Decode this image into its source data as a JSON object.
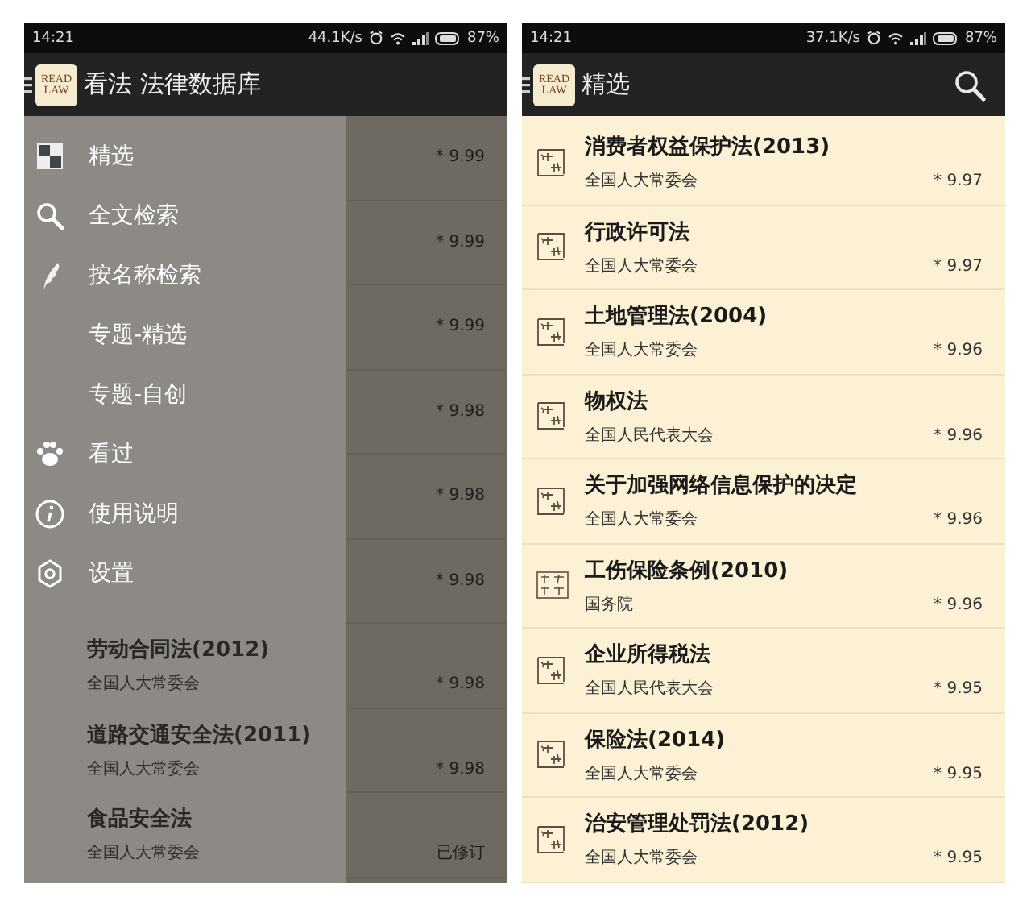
{
  "screens": [
    {
      "status_bar": {
        "time": "14:21",
        "speed": "44.1K/s",
        "battery": "87%"
      },
      "app_bar": {
        "logo_top": "READ",
        "logo_bottom": "LAW",
        "title": "看法 法律数据库",
        "search": false
      },
      "list": [
        {
          "rating": "* 9.99"
        },
        {
          "rating": "* 9.99"
        },
        {
          "rating": "* 9.99"
        },
        {
          "rating": "* 9.98"
        },
        {
          "rating": "* 9.98"
        },
        {
          "rating": "* 9.98"
        },
        {
          "title": "劳动合同法(2012)",
          "subtitle": "全国人大常委会",
          "rating": "* 9.98"
        },
        {
          "title": "道路交通安全法(2011)",
          "subtitle": "全国人大常委会",
          "rating": "* 9.98"
        },
        {
          "title": "食品安全法",
          "subtitle": "全国人大常委会",
          "rating": "已修订"
        }
      ],
      "drawer": {
        "open": true,
        "items": [
          "精选",
          "全文检索",
          "按名称检索",
          "专题-精选",
          "专题-自创",
          "看过",
          "使用说明",
          "设置"
        ]
      }
    },
    {
      "status_bar": {
        "time": "14:21",
        "speed": "37.1K/s",
        "battery": "87%"
      },
      "app_bar": {
        "logo_top": "READ",
        "logo_bottom": "LAW",
        "title": "精选",
        "search": true
      },
      "list": [
        {
          "kind": "law",
          "title": "消费者权益保护法(2013)",
          "subtitle": "全国人大常委会",
          "rating": "* 9.97"
        },
        {
          "kind": "law",
          "title": "行政许可法",
          "subtitle": "全国人大常委会",
          "rating": "* 9.97"
        },
        {
          "kind": "law",
          "title": "土地管理法(2004)",
          "subtitle": "全国人大常委会",
          "rating": "* 9.96"
        },
        {
          "kind": "law",
          "title": "物权法",
          "subtitle": "全国人民代表大会",
          "rating": "* 9.96"
        },
        {
          "kind": "law",
          "title": "关于加强网络信息保护的决定",
          "subtitle": "全国人大常委会",
          "rating": "* 9.96"
        },
        {
          "kind": "regulation",
          "title": "工伤保险条例(2010)",
          "subtitle": "国务院",
          "rating": "* 9.96"
        },
        {
          "kind": "law",
          "title": "企业所得税法",
          "subtitle": "全国人民代表大会",
          "rating": "* 9.95"
        },
        {
          "kind": "law",
          "title": "保险法(2014)",
          "subtitle": "全国人大常委会",
          "rating": "* 9.95"
        },
        {
          "kind": "law",
          "title": "治安管理处罚法(2012)",
          "subtitle": "全国人大常委会",
          "rating": "* 9.95"
        }
      ],
      "drawer": {
        "open": false
      }
    }
  ]
}
